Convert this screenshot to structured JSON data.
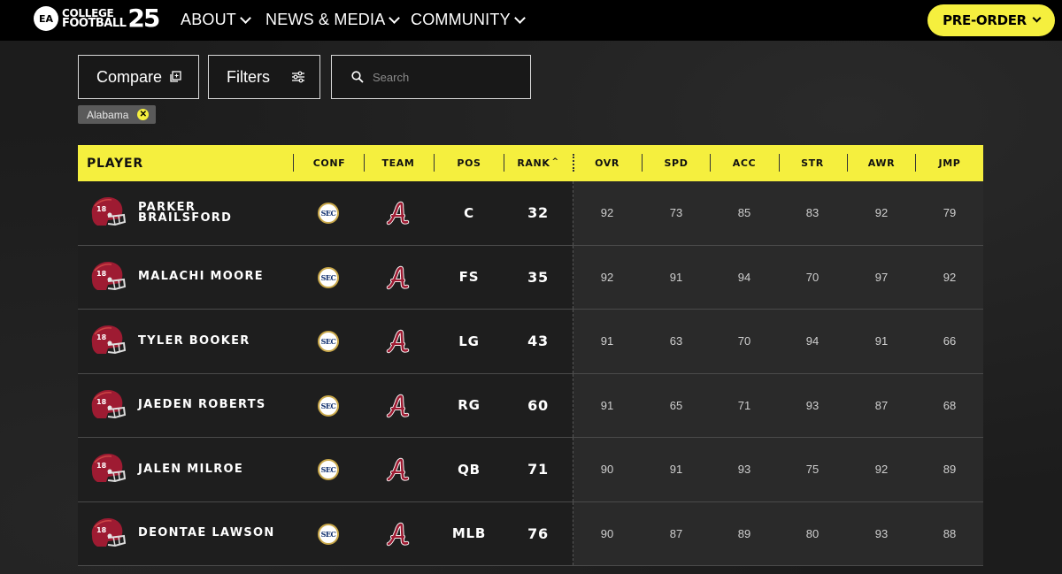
{
  "nav": {
    "logo": {
      "badge": "EA",
      "line1": "COLLEGE",
      "line2": "FOOTBALL",
      "number": "25"
    },
    "items": [
      {
        "label": "ABOUT"
      },
      {
        "label": "NEWS & MEDIA"
      },
      {
        "label": "COMMUNITY"
      }
    ],
    "preorder_label": "PRE-ORDER"
  },
  "controls": {
    "compare_label": "Compare",
    "filters_label": "Filters",
    "search_placeholder": "Search",
    "active_filter": "Alabama"
  },
  "table": {
    "headers": {
      "player": "PLAYER",
      "conf": "CONF",
      "team": "TEAM",
      "pos": "POS",
      "rank": "RANK",
      "ovr": "OVR",
      "spd": "SPD",
      "acc": "ACC",
      "str": "STR",
      "awr": "AWR",
      "jmp": "JMP"
    },
    "sort_column": "rank",
    "conference_label": "SEC",
    "helmet_number": "18",
    "colors": {
      "accent": "#f5ef3e",
      "team_crimson": "#9e1b32",
      "conf_navy": "#0b2b6b",
      "conf_gold": "#c9a84a"
    },
    "rows": [
      {
        "name": "PARKER BRAILSFORD",
        "pos": "C",
        "rank": "32",
        "ovr": "92",
        "spd": "73",
        "acc": "85",
        "str": "83",
        "awr": "92",
        "jmp": "79"
      },
      {
        "name": "MALACHI MOORE",
        "pos": "FS",
        "rank": "35",
        "ovr": "92",
        "spd": "91",
        "acc": "94",
        "str": "70",
        "awr": "97",
        "jmp": "92"
      },
      {
        "name": "TYLER BOOKER",
        "pos": "LG",
        "rank": "43",
        "ovr": "91",
        "spd": "63",
        "acc": "70",
        "str": "94",
        "awr": "91",
        "jmp": "66"
      },
      {
        "name": "JAEDEN ROBERTS",
        "pos": "RG",
        "rank": "60",
        "ovr": "91",
        "spd": "65",
        "acc": "71",
        "str": "93",
        "awr": "87",
        "jmp": "68"
      },
      {
        "name": "JALEN MILROE",
        "pos": "QB",
        "rank": "71",
        "ovr": "90",
        "spd": "91",
        "acc": "93",
        "str": "75",
        "awr": "92",
        "jmp": "89"
      },
      {
        "name": "DEONTAE LAWSON",
        "pos": "MLB",
        "rank": "76",
        "ovr": "90",
        "spd": "87",
        "acc": "89",
        "str": "80",
        "awr": "93",
        "jmp": "88"
      }
    ]
  }
}
